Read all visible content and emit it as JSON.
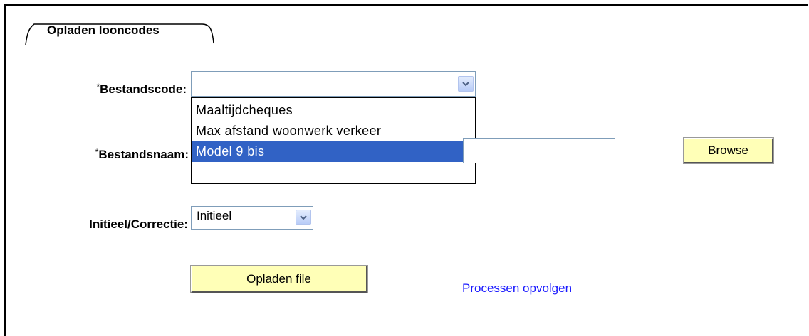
{
  "tab": {
    "label": "Opladen looncodes"
  },
  "form": {
    "bestandscode": {
      "required_mark": "*",
      "label": "Bestandscode:",
      "value": "",
      "options": [
        {
          "label": "Maaltijdcheques",
          "selected": false
        },
        {
          "label": "Max afstand woonwerk verkeer",
          "selected": false
        },
        {
          "label": "Model 9 bis",
          "selected": true
        },
        {
          "label": "",
          "selected": false
        }
      ]
    },
    "bestandsnaam": {
      "required_mark": "*",
      "label": "Bestandsnaam:",
      "value": ""
    },
    "initieel": {
      "label": "Initieel/Correctie:",
      "value": "Initieel"
    }
  },
  "buttons": {
    "browse": "Browse",
    "upload": "Opladen file"
  },
  "links": {
    "processen": "Processen opvolgen"
  },
  "icons": {
    "dropdown": "chevron-down-icon"
  },
  "colors": {
    "button_bg": "#ffffb7",
    "selection": "#3162c5",
    "link": "#1a1aff"
  }
}
